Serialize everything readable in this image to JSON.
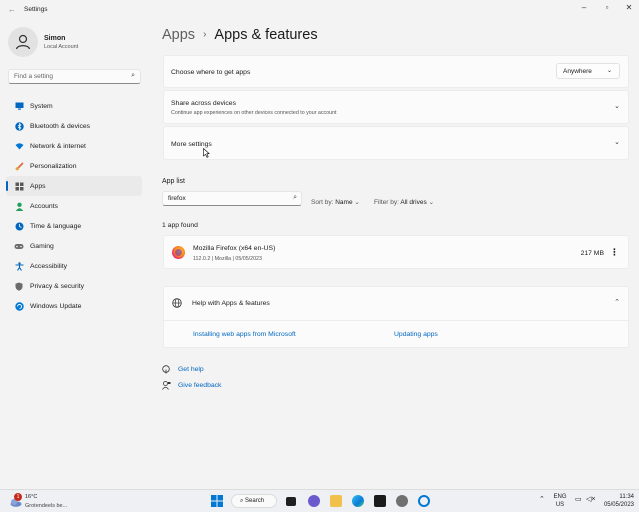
{
  "window": {
    "title": "Settings"
  },
  "user": {
    "name": "Simon",
    "account": "Local Account"
  },
  "search": {
    "placeholder": "Find a setting"
  },
  "nav": [
    {
      "label": "System",
      "icon": "monitor-icon",
      "color": "#0067c0"
    },
    {
      "label": "Bluetooth & devices",
      "icon": "bluetooth-icon",
      "color": "#0067c0"
    },
    {
      "label": "Network & internet",
      "icon": "wifi-icon",
      "color": "#0078d4"
    },
    {
      "label": "Personalization",
      "icon": "brush-icon",
      "color": "#d86b35"
    },
    {
      "label": "Apps",
      "icon": "apps-icon",
      "color": "#5a5a5a"
    },
    {
      "label": "Accounts",
      "icon": "person-icon",
      "color": "#20a05a"
    },
    {
      "label": "Time & language",
      "icon": "globe-clock-icon",
      "color": "#0067c0"
    },
    {
      "label": "Gaming",
      "icon": "gamepad-icon",
      "color": "#6b6b6b"
    },
    {
      "label": "Accessibility",
      "icon": "accessibility-icon",
      "color": "#0067c0"
    },
    {
      "label": "Privacy & security",
      "icon": "shield-icon",
      "color": "#6b6b6b"
    },
    {
      "label": "Windows Update",
      "icon": "update-icon",
      "color": "#0078d4"
    }
  ],
  "breadcrumb": {
    "parent": "Apps",
    "current": "Apps & features"
  },
  "settings": {
    "where": {
      "label": "Choose where to get apps",
      "value": "Anywhere"
    },
    "share": {
      "label": "Share across devices",
      "sub": "Continue app experiences on other devices connected to your account"
    },
    "more": {
      "label": "More settings"
    }
  },
  "applist": {
    "title": "App list",
    "search_value": "firefox",
    "sort_label": "Sort by:",
    "sort_value": "Name",
    "filter_label": "Filter by:",
    "filter_value": "All drives",
    "count": "1 app found"
  },
  "apps": [
    {
      "name": "Mozilla Firefox (x64 en-US)",
      "meta": "112.0.2  |  Mozilla  |  05/05/2023",
      "size": "217 MB"
    }
  ],
  "help": {
    "title": "Help with Apps & features",
    "links": [
      "Installing web apps from Microsoft",
      "Updating apps"
    ]
  },
  "footer": {
    "get_help": "Get help",
    "feedback": "Give feedback"
  },
  "taskbar": {
    "weather_temp": "16°C",
    "weather_desc": "Grotendeels be...",
    "badge": "1",
    "search": "Search",
    "lang": "ENG",
    "region": "US",
    "time": "11:34",
    "date": "05/05/2023"
  }
}
